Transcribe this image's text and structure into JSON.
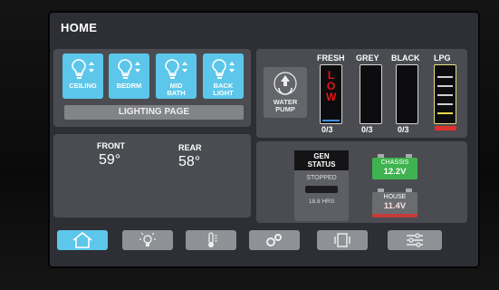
{
  "page": {
    "title": "HOME"
  },
  "lighting": {
    "buttons": [
      {
        "label": "CEILING",
        "icon": "bulb-icon"
      },
      {
        "label": "BEDRM",
        "icon": "bulb-icon"
      },
      {
        "label": "MID\nBATH",
        "icon": "bulb-icon"
      },
      {
        "label": "BACK\nLIGHT",
        "icon": "bulb-icon"
      }
    ],
    "page_button_label": "LIGHTING PAGE"
  },
  "water": {
    "pump_label": "WATER\nPUMP",
    "pump_icon": "recycle-icon"
  },
  "tanks": [
    {
      "name": "FRESH",
      "value": "0/3",
      "status": "L\nO\nW",
      "level": 0
    },
    {
      "name": "GREY",
      "value": "0/3",
      "level": 0
    },
    {
      "name": "BLACK",
      "value": "0/3",
      "level": 0
    },
    {
      "name": "LPG",
      "value": "",
      "level": 0.75
    }
  ],
  "temps": {
    "front_label": "FRONT",
    "front_value": "59°",
    "rear_label": "REAR",
    "rear_value": "58°"
  },
  "generator": {
    "title": "GEN\nSTATUS",
    "state": "STOPPED",
    "hours": "18.8 HRS"
  },
  "batteries": [
    {
      "name": "CHASSIS",
      "value": "12.2V",
      "color": "#3fb34f"
    },
    {
      "name": "HOUSE",
      "value": "11.4V",
      "color": "#c83a3a"
    }
  ],
  "nav": [
    {
      "icon": "home-icon",
      "active": true
    },
    {
      "icon": "lightbulb-icon"
    },
    {
      "icon": "thermometer-icon"
    },
    {
      "icon": "gears-icon"
    },
    {
      "icon": "slideout-icon"
    },
    {
      "icon": "sliders-icon"
    }
  ],
  "colors": {
    "accent": "#5cc7ea",
    "panel": "#4a4c51",
    "low": "#e11111",
    "lpg_low": "#e03030"
  }
}
